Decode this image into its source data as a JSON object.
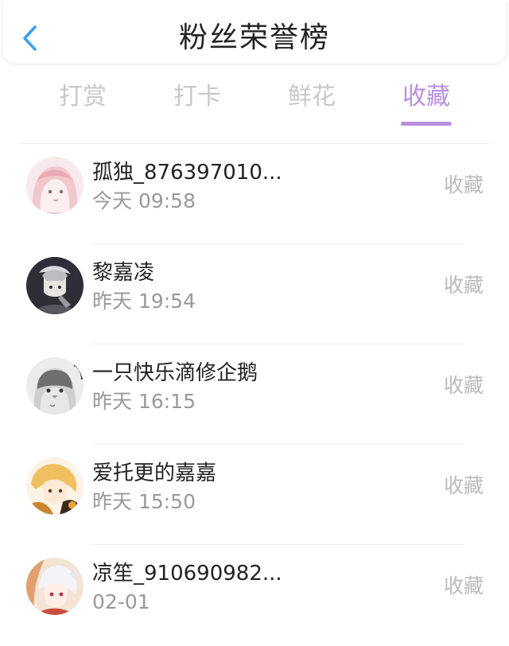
{
  "header": {
    "title": "粉丝荣誉榜",
    "back_icon": "chevron-left-icon",
    "back_color": "#3a9ff0"
  },
  "tabs": [
    {
      "label": "打赏",
      "active": false
    },
    {
      "label": "打卡",
      "active": false
    },
    {
      "label": "鲜花",
      "active": false
    },
    {
      "label": "收藏",
      "active": true
    }
  ],
  "colors": {
    "accent": "#b98fe0",
    "tab_inactive": "#c8c8c8",
    "name": "#222222",
    "time": "#999999",
    "action": "#bbbbbb"
  },
  "list": [
    {
      "name": "孤独_876397010...",
      "time": "今天 09:58",
      "action": "收藏",
      "avatar": "anime-girl-avatar"
    },
    {
      "name": "黎嘉凌",
      "time": "昨天 19:54",
      "action": "收藏",
      "avatar": "dark-anime-avatar"
    },
    {
      "name": "一只快乐滴修企鹅",
      "time": "昨天 16:15",
      "action": "收藏",
      "avatar": "penguin-avatar"
    },
    {
      "name": "爱托更的嘉嘉",
      "time": "昨天 15:50",
      "action": "收藏",
      "avatar": "blonde-anime-avatar"
    },
    {
      "name": "凉笙_910690982...",
      "time": "02-01",
      "action": "收藏",
      "avatar": "white-hair-anime-avatar"
    }
  ]
}
